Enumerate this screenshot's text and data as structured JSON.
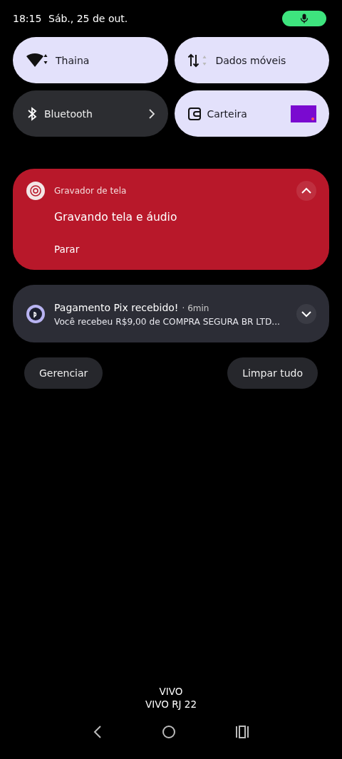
{
  "status": {
    "time": "18:15",
    "date": "Sáb., 25 de out."
  },
  "tiles": [
    {
      "kind": "wifi",
      "label": "Thaina",
      "on": true
    },
    {
      "kind": "data",
      "label": "Dados móveis",
      "on": true
    },
    {
      "kind": "bluetooth",
      "label": "Bluetooth",
      "on": false
    },
    {
      "kind": "wallet",
      "label": "Carteira",
      "on": true
    }
  ],
  "notifications": [
    {
      "kind": "recorder",
      "app": "Gravador de tela",
      "title": "Gravando tela e áudio",
      "action": "Parar",
      "expanded": true
    },
    {
      "kind": "pix",
      "title": "Pagamento Pix recebido!",
      "time": "· 6min",
      "text": "Você recebeu R$9,00 de COMPRA SEGURA BR LTD...",
      "expanded": false
    }
  ],
  "buttons": [
    "Gerenciar",
    "Limpar tudo"
  ],
  "carrier": [
    "VIVO",
    "VIVO RJ 22"
  ]
}
